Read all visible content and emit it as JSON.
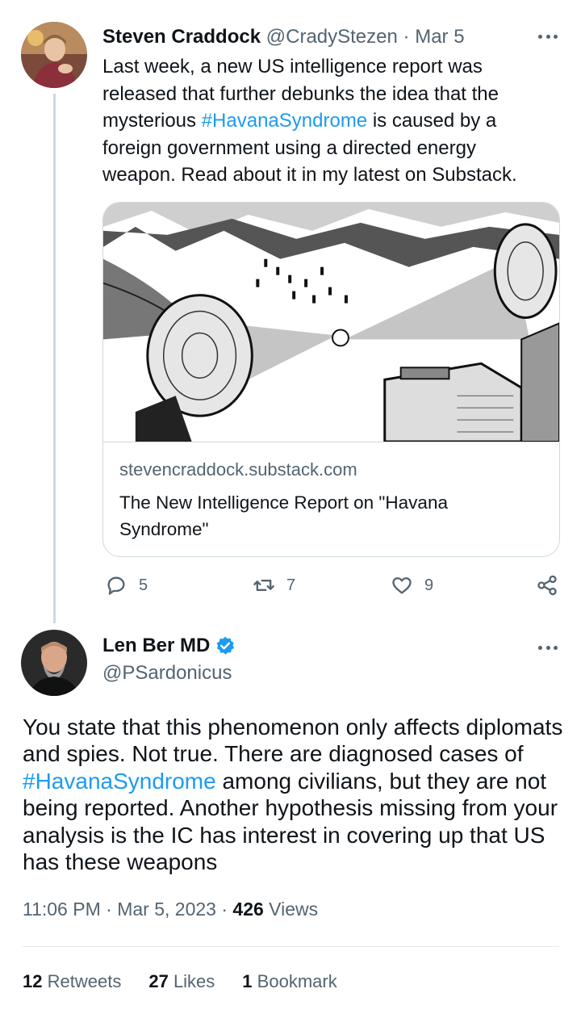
{
  "tweet1": {
    "author_name": "Steven Craddock",
    "author_handle": "@CradyStezen",
    "separator": "·",
    "date": "Mar 5",
    "text_before": "Last week, a new US intelligence report was released that further debunks the idea that the mysterious ",
    "hashtag": "#HavanaSyndrome",
    "text_after": " is caused by a foreign government using a directed energy weapon. Read about it in my latest on Substack.",
    "card": {
      "domain": "stevencraddock.substack.com",
      "title": "The New Intelligence Report on \"Havana Syndrome\""
    },
    "actions": {
      "replies": "5",
      "retweets": "7",
      "likes": "9"
    }
  },
  "tweet2": {
    "author_name": "Len Ber MD",
    "author_handle": "@PSardonicus",
    "text_before": "You state that this phenomenon only affects diplomats and spies. Not true. There are diagnosed cases of ",
    "hashtag": "#HavanaSyndrome",
    "text_after": " among civilians, but they are not being reported. Another hypothesis missing from your analysis is the IC has interest in covering up that US has these weapons",
    "time": "11:06 PM",
    "separator": "·",
    "full_date": "Mar 5, 2023",
    "views_count": "426",
    "views_label": "Views",
    "stats": {
      "retweets_count": "12",
      "retweets_label": "Retweets",
      "likes_count": "27",
      "likes_label": "Likes",
      "bookmarks_count": "1",
      "bookmarks_label": "Bookmark"
    }
  },
  "colors": {
    "link": "#1d9bf0",
    "secondary_text": "#536471",
    "border": "#cfd9de",
    "verified": "#1d9bf0"
  },
  "icons": [
    "more-icon",
    "reply-icon",
    "retweet-icon",
    "like-icon",
    "share-icon",
    "verified-icon"
  ]
}
